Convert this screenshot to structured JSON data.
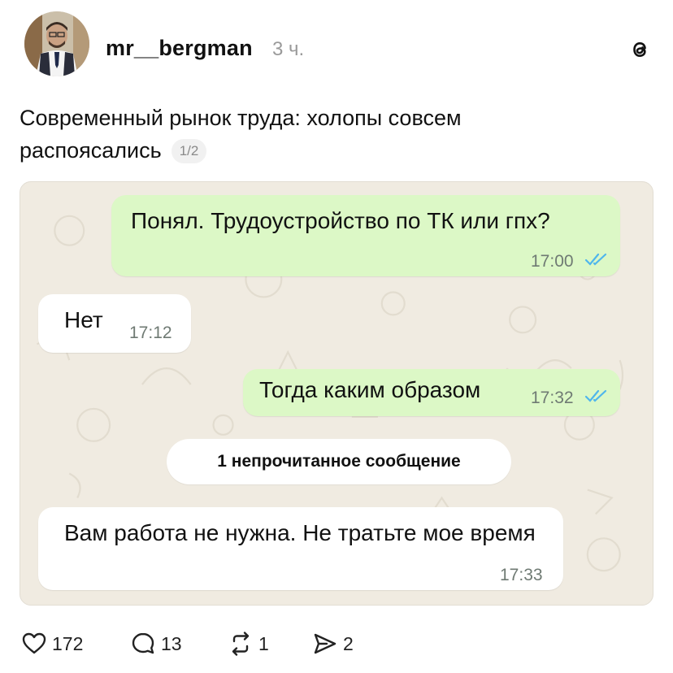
{
  "post": {
    "username": "mr__bergman",
    "time_ago": "3 ч.",
    "caption": "Современный рынок труда: холопы совсем распоясались",
    "page_counter": "1/2"
  },
  "chat": {
    "messages": [
      {
        "direction": "out",
        "text": "Понял. Трудоустройство по ТК или гпх?",
        "time": "17:00",
        "read": true
      },
      {
        "direction": "in",
        "text": "Нет",
        "time": "17:12"
      },
      {
        "direction": "out",
        "text": "Тогда каким образом",
        "time": "17:32",
        "read": true
      },
      {
        "direction": "in",
        "text": "Вам работа не нужна. Не тратьте мое время",
        "time": "17:33"
      }
    ],
    "unread_banner": "1 непрочитанное сообщение",
    "colors": {
      "outgoing": "#dcf8c6",
      "incoming": "#ffffff",
      "read_ticks": "#4fb6ec",
      "wallpaper": "#f0ebe1"
    }
  },
  "actions": {
    "likes": "172",
    "comments": "13",
    "reposts": "1",
    "shares": "2"
  },
  "icons": [
    "avatar-photo",
    "threads-logo-icon",
    "heart-icon",
    "comment-icon",
    "repost-icon",
    "share-icon",
    "double-check-icon"
  ]
}
